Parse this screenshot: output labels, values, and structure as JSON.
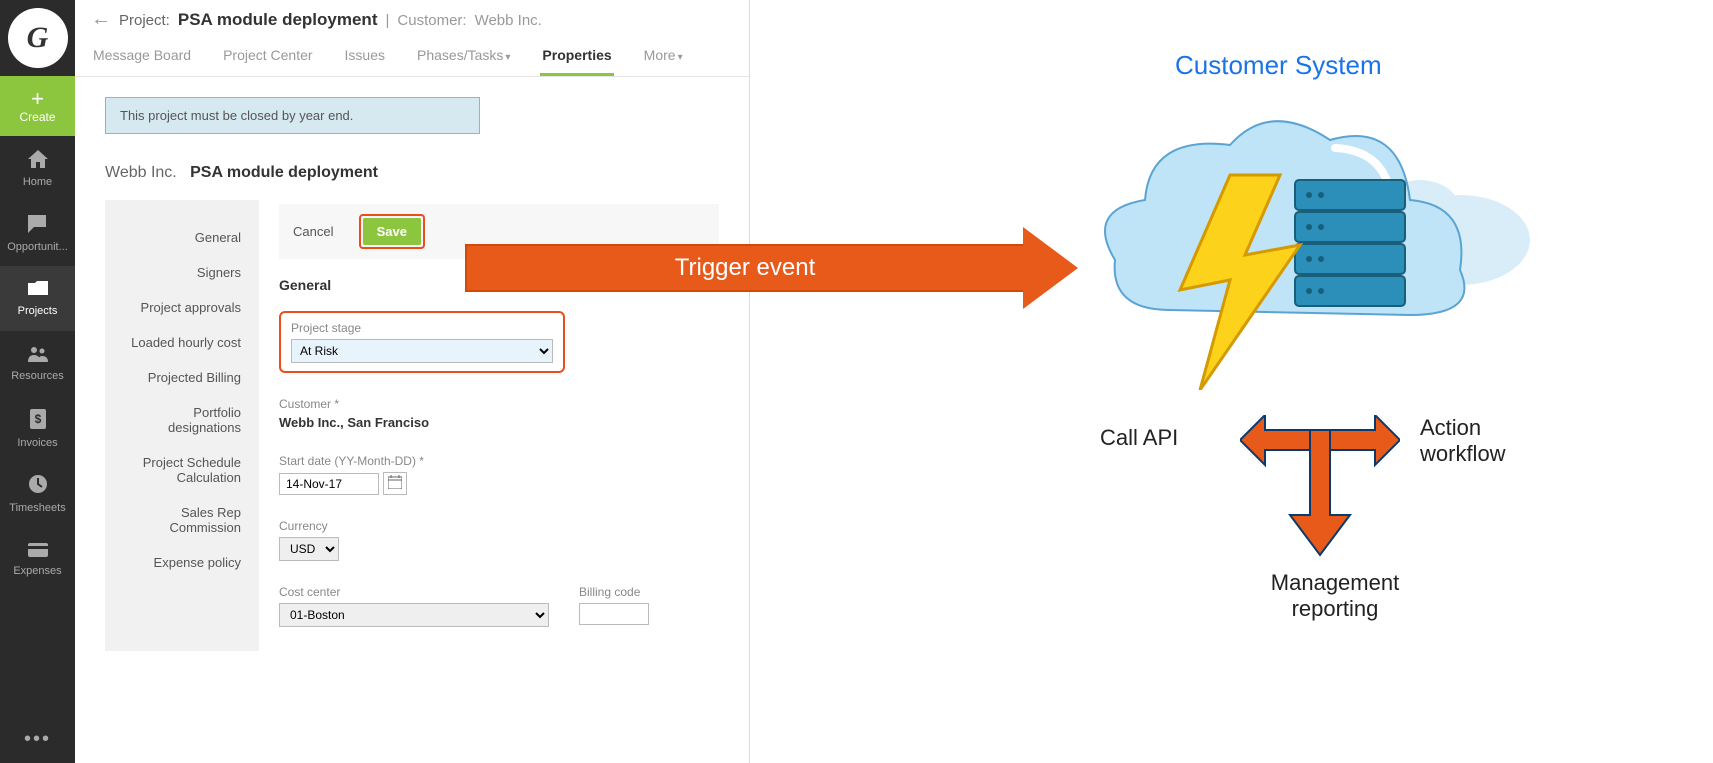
{
  "sidebar": {
    "logo_letter": "G",
    "create_label": "Create",
    "items": [
      {
        "label": "Home",
        "icon": "home"
      },
      {
        "label": "Opportunit...",
        "icon": "chat"
      },
      {
        "label": "Projects",
        "icon": "folder"
      },
      {
        "label": "Resources",
        "icon": "people"
      },
      {
        "label": "Invoices",
        "icon": "invoice"
      },
      {
        "label": "Timesheets",
        "icon": "clock"
      },
      {
        "label": "Expenses",
        "icon": "card"
      }
    ]
  },
  "header": {
    "project_prefix": "Project:",
    "project_name": "PSA module deployment",
    "customer_prefix": "Customer:",
    "customer_name": "Webb Inc.",
    "tabs": [
      {
        "label": "Message Board"
      },
      {
        "label": "Project Center"
      },
      {
        "label": "Issues"
      },
      {
        "label": "Phases/Tasks",
        "dropdown": true
      },
      {
        "label": "Properties",
        "active": true
      },
      {
        "label": "More",
        "dropdown": true
      }
    ]
  },
  "notice_text": "This project must be closed by year end.",
  "breadcrumb": {
    "customer": "Webb Inc.",
    "project": "PSA module deployment"
  },
  "side_menu": [
    "General",
    "Signers",
    "Project approvals",
    "Loaded hourly cost",
    "Projected Billing",
    "Portfolio designations",
    "Project Schedule Calculation",
    "Sales Rep Commission",
    "Expense policy"
  ],
  "actions": {
    "cancel": "Cancel",
    "save": "Save"
  },
  "form": {
    "section_title": "General",
    "stage_label": "Project stage",
    "stage_value": "At Risk",
    "customer_label": "Customer  *",
    "customer_value": "Webb Inc., San Franciso",
    "start_label": "Start date (YY-Month-DD)  *",
    "start_value": "14-Nov-17",
    "currency_label": "Currency",
    "currency_value": "USD",
    "cost_center_label": "Cost center",
    "cost_center_value": "01-Boston",
    "billing_code_label": "Billing code",
    "billing_code_value": ""
  },
  "diagram": {
    "cs_title": "Customer System",
    "trigger_label": "Trigger event",
    "call_api": "Call API",
    "action_workflow": "Action workflow",
    "mgmt_reporting": "Management reporting"
  }
}
